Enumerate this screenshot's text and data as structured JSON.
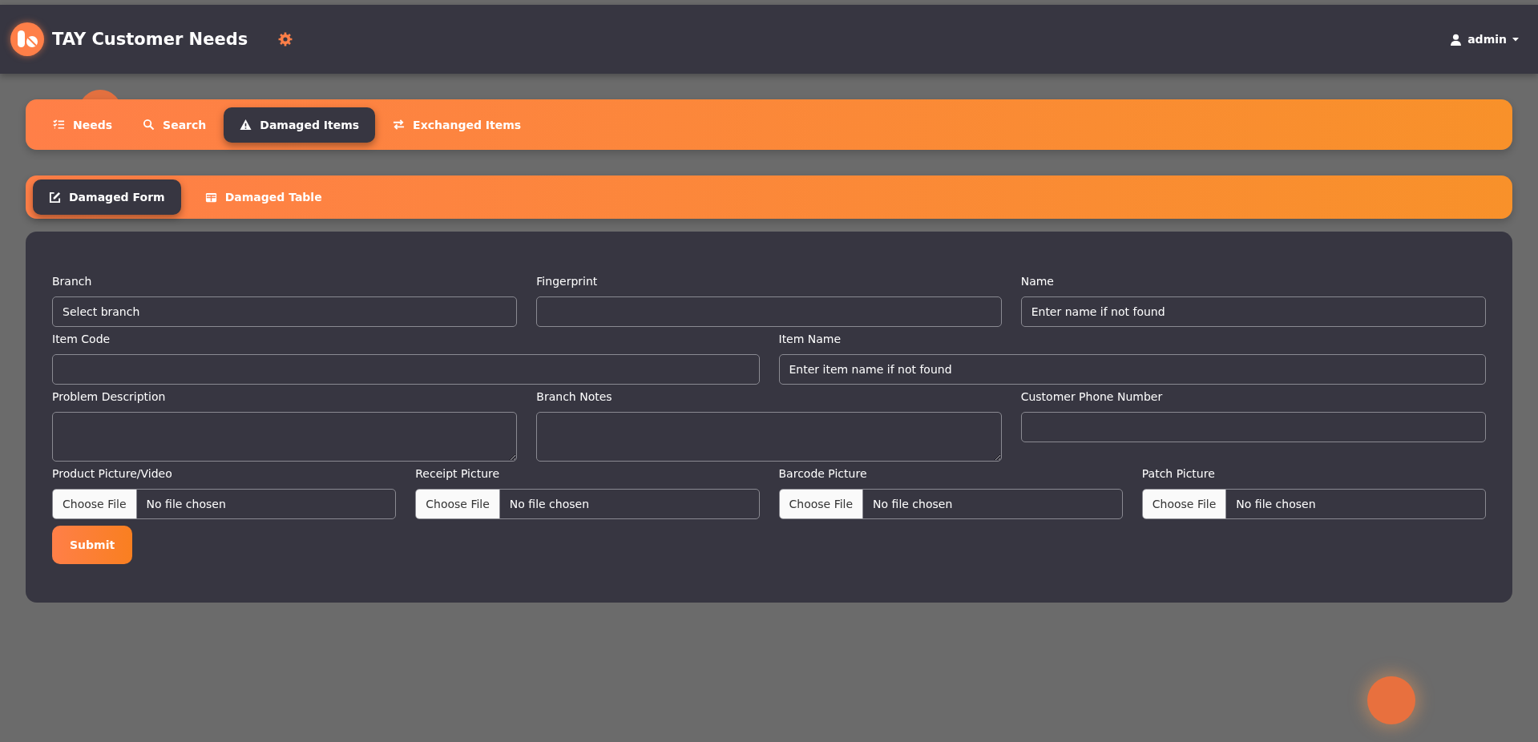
{
  "header": {
    "title": "TAY Customer Needs",
    "user": "admin"
  },
  "nav": {
    "tabs": [
      {
        "label": "Needs",
        "selected": false
      },
      {
        "label": "Search",
        "selected": false
      },
      {
        "label": "Damaged Items",
        "selected": true
      },
      {
        "label": "Exchanged Items",
        "selected": false
      }
    ]
  },
  "subnav": {
    "tabs": [
      {
        "label": "Damaged Form",
        "selected": true
      },
      {
        "label": "Damaged Table",
        "selected": false
      }
    ]
  },
  "form": {
    "rows": [
      [
        {
          "kind": "select",
          "label": "Branch",
          "value": "Select branch"
        },
        {
          "kind": "text",
          "label": "Fingerprint"
        },
        {
          "kind": "text",
          "label": "Name",
          "placeholder": "Enter name if not found"
        }
      ],
      [
        {
          "kind": "text",
          "label": "Item Code"
        },
        {
          "kind": "text",
          "label": "Item Name",
          "placeholder": "Enter item name if not found"
        }
      ],
      [
        {
          "kind": "textarea",
          "label": "Problem Description"
        },
        {
          "kind": "textarea",
          "label": "Branch Notes"
        },
        {
          "kind": "text",
          "label": "Customer Phone Number"
        }
      ],
      [
        {
          "kind": "file",
          "label": "Product Picture/Video",
          "button": "Choose File",
          "status": "No file chosen"
        },
        {
          "kind": "file",
          "label": "Receipt Picture",
          "button": "Choose File",
          "status": "No file chosen"
        },
        {
          "kind": "file",
          "label": "Barcode Picture",
          "button": "Choose File",
          "status": "No file chosen"
        },
        {
          "kind": "file",
          "label": "Patch Picture",
          "button": "Choose File",
          "status": "No file chosen"
        }
      ]
    ],
    "submit": "Submit"
  }
}
